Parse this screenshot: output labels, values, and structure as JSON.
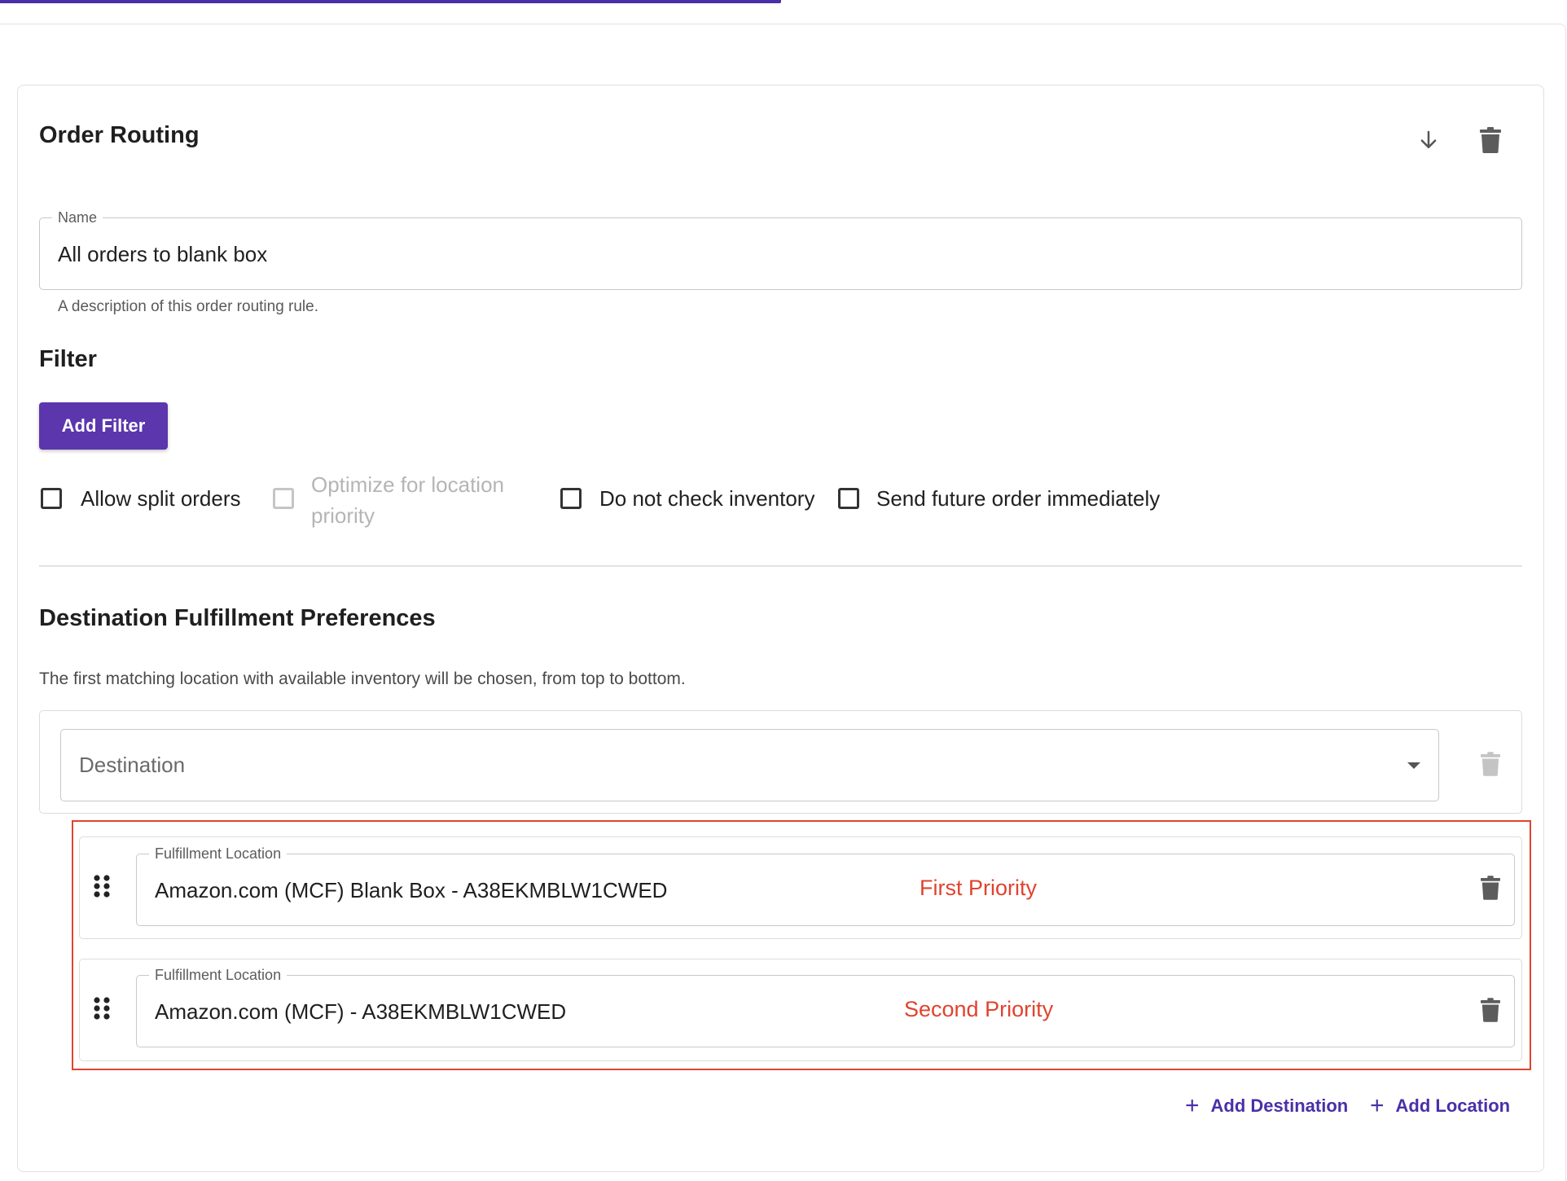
{
  "card": {
    "title": "Order Routing",
    "actions": {
      "move_down_icon": "arrow-down-icon",
      "delete_icon": "trash-icon"
    }
  },
  "name_field": {
    "label": "Name",
    "value": "All orders to blank box",
    "helper": "A description of this order routing rule."
  },
  "filter": {
    "title": "Filter",
    "add_button": "Add Filter"
  },
  "options": [
    {
      "label": "Allow split orders",
      "checked": false,
      "disabled": false
    },
    {
      "label": "Optimize for location priority",
      "line1": "Optimize for location",
      "line2": "priority",
      "checked": false,
      "disabled": true
    },
    {
      "label": "Do not check inventory",
      "checked": false,
      "disabled": false
    },
    {
      "label": "Send future order immediately",
      "checked": false,
      "disabled": false
    }
  ],
  "destinations": {
    "title": "Destination Fulfillment Preferences",
    "description": "The first matching location with available inventory will be chosen, from top to bottom.",
    "destination_placeholder": "Destination",
    "locations": [
      {
        "label": "Fulfillment Location",
        "value": "Amazon.com (MCF) Blank Box - A38EKMBLW1CWED",
        "annotation": "First Priority"
      },
      {
        "label": "Fulfillment Location",
        "value": "Amazon.com (MCF) - A38EKMBLW1CWED",
        "annotation": "Second Priority"
      }
    ],
    "add_destination": "Add Destination",
    "add_location": "Add Location"
  },
  "colors": {
    "accent": "#5b36ac",
    "link": "#4a2fa8",
    "annotation_red": "#e0432f"
  }
}
